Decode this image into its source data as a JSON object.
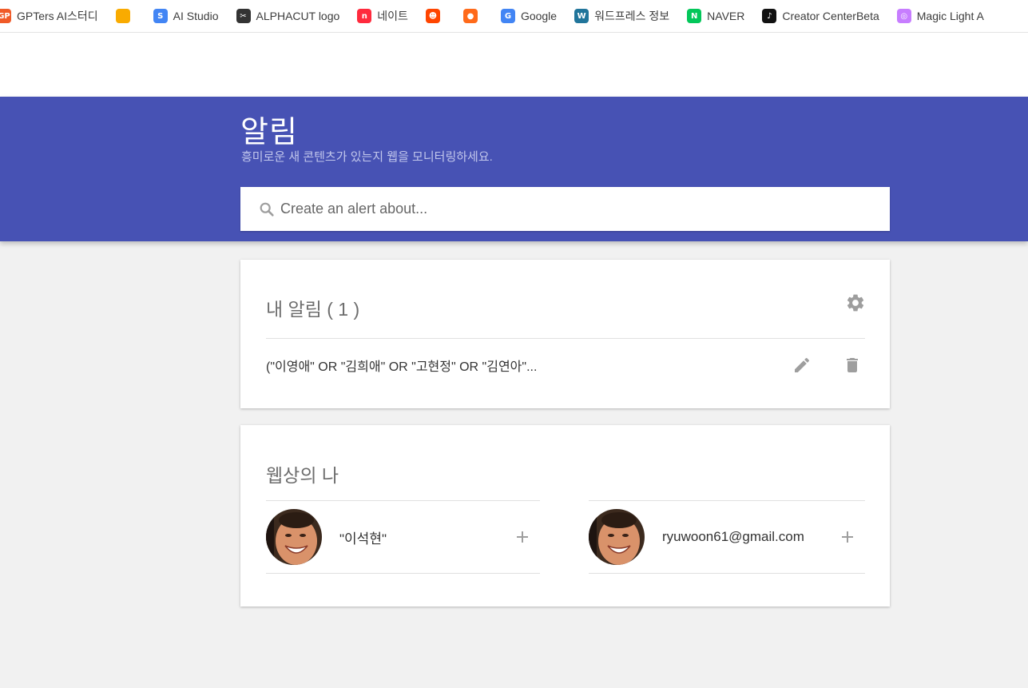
{
  "bookmarks": [
    {
      "label": "GPTers AI스터디",
      "icon": "gpters-icon",
      "color": "#f05a28",
      "glyph": "GP"
    },
    {
      "label": "",
      "icon": "analytics-icon",
      "color": "#f9ab00",
      "glyph": ""
    },
    {
      "label": "AI Studio",
      "icon": "ai-studio-icon",
      "color": "#4285f4",
      "glyph": "S"
    },
    {
      "label": "ALPHACUT logo",
      "icon": "alphacut-icon",
      "color": "#333333",
      "glyph": "✂"
    },
    {
      "label": "네이트",
      "icon": "nate-icon",
      "color": "#ff2a3d",
      "glyph": "n"
    },
    {
      "label": "",
      "icon": "reddit-icon",
      "color": "#ff4500",
      "glyph": "☻"
    },
    {
      "label": "",
      "icon": "bookmark-orange-icon",
      "color": "#ff6a1a",
      "glyph": "●"
    },
    {
      "label": "Google",
      "icon": "google-icon",
      "color": "#4285f4",
      "glyph": "G"
    },
    {
      "label": "워드프레스 정보",
      "icon": "wordpress-icon",
      "color": "#21759b",
      "glyph": "W"
    },
    {
      "label": "NAVER",
      "icon": "naver-icon",
      "color": "#03c75a",
      "glyph": "N"
    },
    {
      "label": "Creator CenterBeta",
      "icon": "tiktok-icon",
      "color": "#111111",
      "glyph": "♪"
    },
    {
      "label": "Magic Light A",
      "icon": "magic-light-icon",
      "color": "#c77dff",
      "glyph": "◎"
    }
  ],
  "header": {
    "title": "알림",
    "subtitle": "흥미로운 새 콘텐츠가 있는지 웹을 모니터링하세요.",
    "search_placeholder": "Create an alert about..."
  },
  "my_alerts": {
    "title": "내 알림 ( 1 )",
    "items": [
      {
        "query": "(\"이영애\" OR \"김희애\" OR \"고현정\" OR \"김연아\"..."
      }
    ]
  },
  "me_on_web": {
    "title": "웹상의 나",
    "items": [
      {
        "label": "\"이석현\""
      },
      {
        "label": "ryuwoon61@gmail.com"
      }
    ]
  },
  "colors": {
    "header_bg": "#4752b4",
    "page_bg": "#f1f1f1",
    "icon_gray": "#9e9e9e"
  }
}
